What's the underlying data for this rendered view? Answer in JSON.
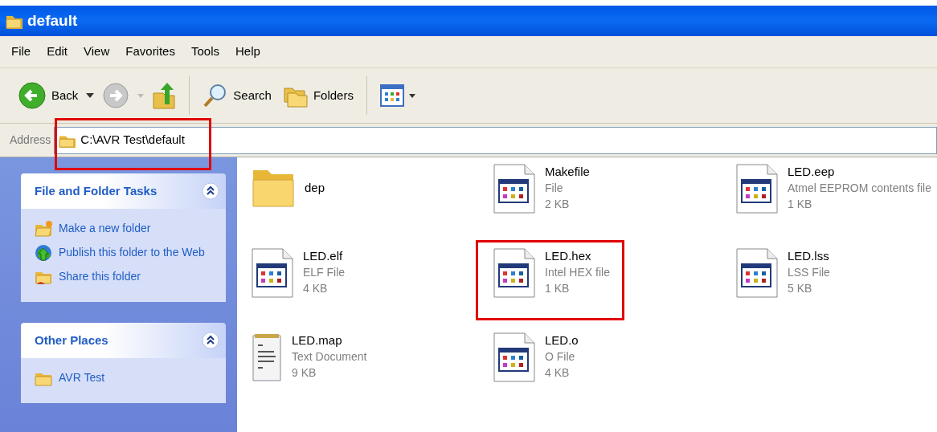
{
  "window": {
    "title": "default"
  },
  "menu": [
    {
      "label": "File"
    },
    {
      "label": "Edit"
    },
    {
      "label": "View"
    },
    {
      "label": "Favorites"
    },
    {
      "label": "Tools"
    },
    {
      "label": "Help"
    }
  ],
  "toolbar": {
    "back": {
      "label": "Back",
      "disabled": false
    },
    "forward": {
      "disabled": true
    },
    "search": {
      "label": "Search"
    },
    "folders": {
      "label": "Folders"
    }
  },
  "address": {
    "label": "Address",
    "value": "C:\\AVR Test\\default",
    "highlighted": true
  },
  "sidebar": {
    "panels": [
      {
        "title": "File and Folder Tasks",
        "expanded": true,
        "items": [
          {
            "kind": "new-folder",
            "label": "Make a new folder"
          },
          {
            "kind": "publish",
            "label": "Publish this folder to the Web"
          },
          {
            "kind": "share",
            "label": "Share this folder"
          }
        ]
      },
      {
        "title": "Other Places",
        "expanded": true,
        "items": [
          {
            "kind": "folder",
            "label": "AVR Test"
          }
        ]
      }
    ]
  },
  "files": [
    {
      "kind": "folder",
      "name": "dep",
      "highlighted": false
    },
    {
      "kind": "program",
      "name": "Makefile",
      "type": "File",
      "size": "2 KB",
      "highlighted": false
    },
    {
      "kind": "program",
      "name": "LED.eep",
      "type": "Atmel EEPROM contents file",
      "size": "1 KB",
      "highlighted": false
    },
    {
      "kind": "program",
      "name": "LED.elf",
      "type": "ELF File",
      "size": "4 KB",
      "highlighted": false
    },
    {
      "kind": "program",
      "name": "LED.hex",
      "type": "Intel HEX file",
      "size": "1 KB",
      "highlighted": true
    },
    {
      "kind": "program",
      "name": "LED.lss",
      "type": "LSS File",
      "size": "5 KB",
      "highlighted": false
    },
    {
      "kind": "text",
      "name": "LED.map",
      "type": "Text Document",
      "size": "9 KB",
      "highlighted": false
    },
    {
      "kind": "program",
      "name": "LED.o",
      "type": "O File",
      "size": "4 KB",
      "highlighted": false
    }
  ]
}
